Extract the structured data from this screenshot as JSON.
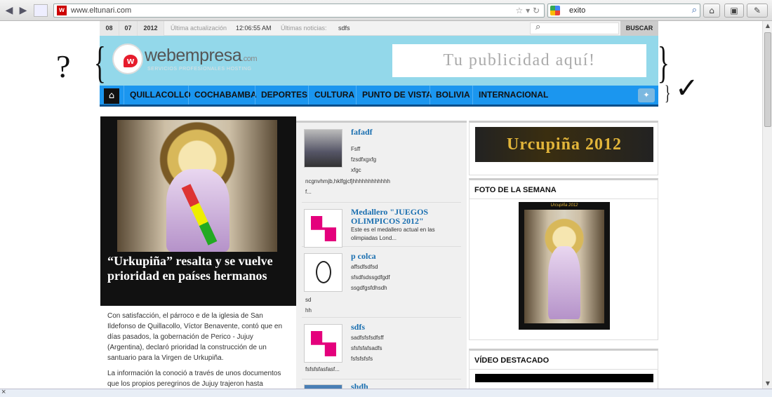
{
  "browser": {
    "url": "www.eltunari.com",
    "search_term": "exito",
    "favicon_letter": "w"
  },
  "topbar": {
    "day": "08",
    "month": "07",
    "year": "2012",
    "updated_label": "Última actualización",
    "updated_time": "12:06:55 AM",
    "news_label": "Últimas noticias:",
    "news_value": "sdfs",
    "search_button": "BUSCAR"
  },
  "header": {
    "logo_main": "webempresa",
    "logo_tld": ".com",
    "logo_tagline": "SERVICIOS PROFESIONALES HOSTING",
    "ad_text": "Tu publicidad aquí!"
  },
  "menu": {
    "items": [
      "QUILLACOLLO",
      "COCHABAMBA",
      "DEPORTES",
      "CULTURA",
      "PUNTO DE VISTA",
      "BOLIVIA",
      "INTERNACIONAL"
    ]
  },
  "annotations": {
    "question": "?",
    "check": "✓"
  },
  "feature": {
    "title": "“Urkupiña” resalta y se vuelve prioridad en países hermanos",
    "paragraphs": [
      "Con satisfacción, el párroco e de la iglesia de San Ildefonso de Quillacollo, Víctor Benavente, contó que en días pasados, la gobernación de Perico  - Jujuy (Argentina), declaró prioridad la construcción de un santuario para la Virgen de Urkupiña.",
      "La información la conoció a través de unos documentos que los propios peregrinos de Jujuy trajeron hasta"
    ]
  },
  "news": [
    {
      "title": "fafadf",
      "lines": [
        "Fsff",
        "fzsdfxgxfg",
        "xfgc"
      ],
      "full": [
        "ncgnvhmjb,hklfgjcfjhhhhhhhhhhhh",
        "f..."
      ]
    },
    {
      "title": "Medallero \"JUEGOS OLIMPICOS 2012\"",
      "lines": [
        "Este es el medallero actual en las",
        "olimpiadas Lond..."
      ],
      "full": []
    },
    {
      "title": "p colca",
      "lines": [
        "affsdfsdfsd",
        "sfsdfsdssgdfgdf",
        "ssgdfgsfdhsdh"
      ],
      "full": [
        "sd",
        "hh"
      ]
    },
    {
      "title": "sdfs",
      "lines": [
        "sadfsfsfsdfsff",
        "sfsfsfafsadfs",
        "fsfsfsfsfs"
      ],
      "full": [
        "fsfsfsfasfasf..."
      ]
    },
    {
      "title": "shdh",
      "lines": [],
      "full": []
    }
  ],
  "right": {
    "banner_text": "Urcupiña 2012",
    "photo_heading": "FOTO DE LA SEMANA",
    "poster_title": "Urcupiña 2012",
    "video_heading": "VÍDEO DESTACADO"
  }
}
